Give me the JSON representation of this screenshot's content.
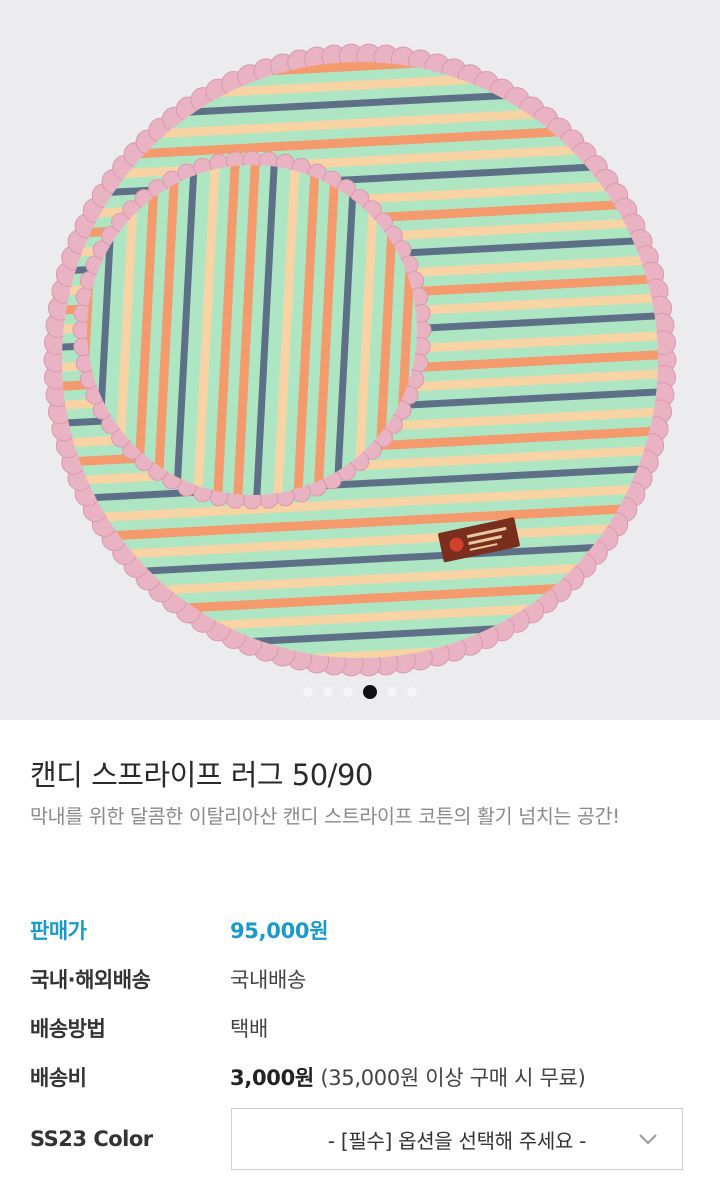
{
  "gallery": {
    "image_alt": "candy stripe rug product photo",
    "slide_count": 6,
    "active_slide": 4,
    "colors": {
      "mint": "#aee6c4",
      "orange": "#f49a6c",
      "peach": "#f8d3a4",
      "navy": "#5d7088",
      "frill": "#eab3c4",
      "background": "#ececee"
    }
  },
  "product": {
    "title": "캔디 스프라이프 러그 50/90",
    "description": "막내를 위한 달콤한 이탈리아산 캔디 스트라이프 코튼의 활기 넘치는 공간!"
  },
  "details": {
    "price_label": "판매가",
    "price_value": "95,000원",
    "shipping_scope_label": "국내·해외배송",
    "shipping_scope_value": "국내배송",
    "shipping_method_label": "배송방법",
    "shipping_method_value": "택배",
    "shipping_fee_label": "배송비",
    "shipping_fee_value": "3,000원",
    "shipping_fee_note": "(35,000원 이상 구매 시 무료)"
  },
  "option": {
    "label": "SS23 Color",
    "placeholder": "- [필수] 옵션을 선택해 주세요 -",
    "icon": "chevron-down-icon"
  },
  "accent_color": "#1b9ac8"
}
